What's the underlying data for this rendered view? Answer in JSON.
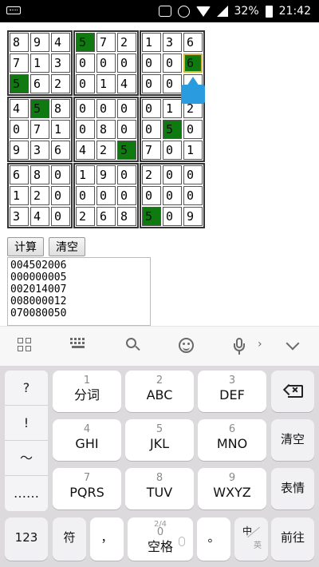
{
  "statusbar": {
    "battery": "32%",
    "time": "21:42"
  },
  "board": [
    [
      "8",
      "9",
      "4",
      "5",
      "7",
      "2",
      "1",
      "3",
      "6"
    ],
    [
      "7",
      "1",
      "3",
      "0",
      "0",
      "0",
      "0",
      "0",
      "6"
    ],
    [
      "5",
      "6",
      "2",
      "0",
      "1",
      "4",
      "0",
      "0",
      ""
    ],
    [
      "4",
      "5",
      "8",
      "0",
      "0",
      "0",
      "0",
      "1",
      "2"
    ],
    [
      "0",
      "7",
      "1",
      "0",
      "8",
      "0",
      "0",
      "5",
      "0"
    ],
    [
      "9",
      "3",
      "6",
      "4",
      "2",
      "5",
      "7",
      "0",
      "1"
    ],
    [
      "6",
      "8",
      "0",
      "1",
      "9",
      "0",
      "2",
      "0",
      "0"
    ],
    [
      "1",
      "2",
      "0",
      "0",
      "0",
      "0",
      "0",
      "0",
      "0"
    ],
    [
      "3",
      "4",
      "0",
      "2",
      "6",
      "8",
      "5",
      "0",
      "9"
    ]
  ],
  "highlighted": [
    [
      0,
      3
    ],
    [
      1,
      8
    ],
    [
      2,
      0
    ],
    [
      3,
      1
    ],
    [
      4,
      7
    ],
    [
      5,
      5
    ],
    [
      8,
      6
    ]
  ],
  "selected": [
    1,
    8
  ],
  "buttons": {
    "compute": "计算",
    "clear": "清空"
  },
  "output_lines": [
    "004502006",
    "000000005",
    "002014007",
    "008000012",
    "070080050"
  ],
  "keyboard": {
    "left_symbols": [
      "?",
      "!",
      "～",
      "……"
    ],
    "keys": [
      {
        "num": "1",
        "label": "分词"
      },
      {
        "num": "2",
        "label": "ABC"
      },
      {
        "num": "3",
        "label": "DEF"
      },
      {
        "num": "4",
        "label": "GHI"
      },
      {
        "num": "5",
        "label": "JKL"
      },
      {
        "num": "6",
        "label": "MNO"
      },
      {
        "num": "7",
        "label": "PQRS"
      },
      {
        "num": "8",
        "label": "TUV"
      },
      {
        "num": "9",
        "label": "WXYZ"
      }
    ],
    "side_keys": {
      "clear": "清空",
      "emoji": "表情"
    },
    "bottom": {
      "num_mode": "123",
      "symbol": "符",
      "comma": "，",
      "space_frac": "2/4",
      "space_num": "0",
      "space_label": "空格",
      "period": "。",
      "lang_zh": "中",
      "lang_en": "英",
      "go": "前往"
    }
  }
}
